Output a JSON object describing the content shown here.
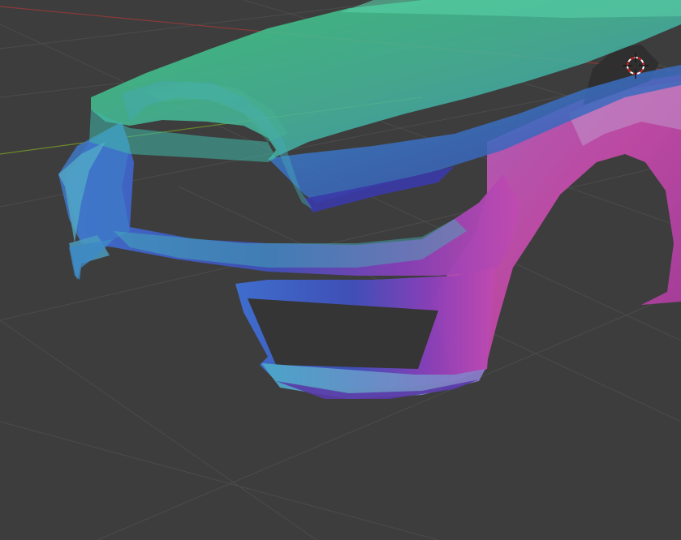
{
  "viewport": {
    "type": "3d-viewport",
    "background_color": "#3d3d3d",
    "grid_color": "#4a4a4a",
    "x_axis_color": "#8a3a3a",
    "y_axis_color": "#6a8a2a",
    "cursor_icon": "3d-cursor-icon"
  },
  "model": {
    "shading": "normal-map",
    "parts": [
      "hood",
      "front-bumper",
      "front-fender",
      "wheel-arch"
    ],
    "colors": {
      "green": "#3fc48a",
      "teal": "#4aa8b0",
      "blue": "#3f4fb8",
      "purple": "#8a3fb0",
      "pink": "#c04aa8"
    }
  }
}
